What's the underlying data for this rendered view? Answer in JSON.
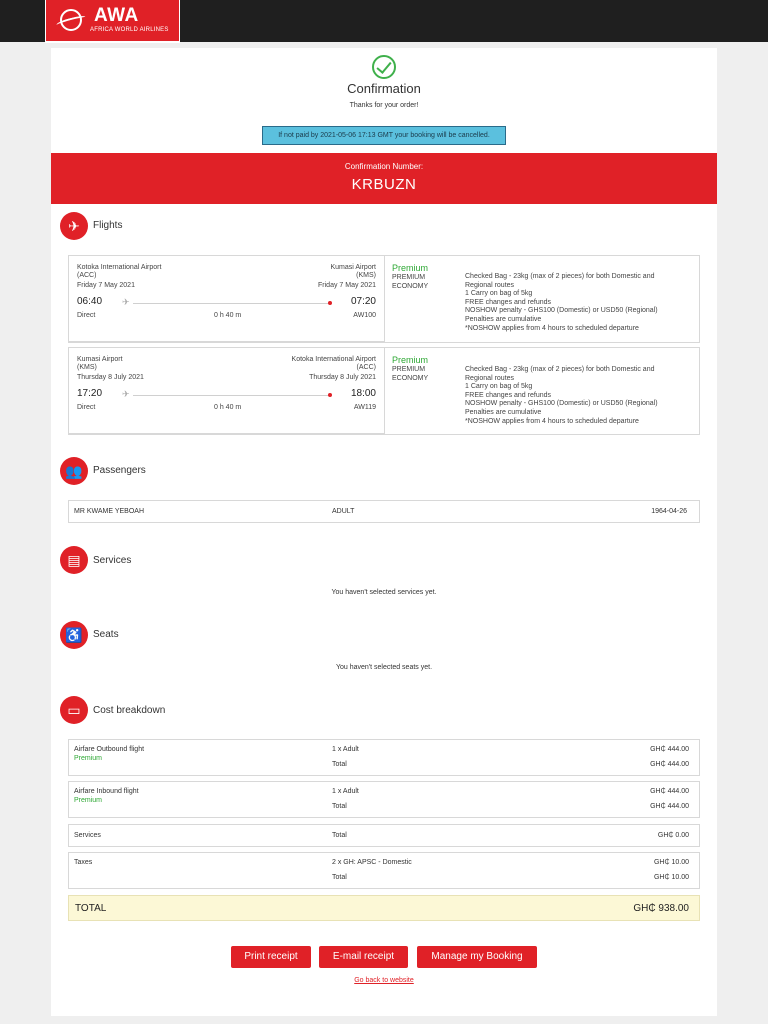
{
  "header": {
    "brand": "AWA",
    "brand_sub": "AFRICA WORLD AIRLINES"
  },
  "confirmation": {
    "title": "Confirmation",
    "thanks": "Thanks for your order!",
    "notice": "If not paid by 2021-05-06 17:13 GMT your booking will be cancelled.",
    "number_label": "Confirmation Number:",
    "number": "KRBUZN"
  },
  "flights": {
    "title": "Flights",
    "items": [
      {
        "from_airport": "Kotoka International Airport",
        "from_code": "(ACC)",
        "from_date": "Friday 7 May 2021",
        "dep_time": "06:40",
        "to_airport": "Kumasi Airport",
        "to_code": "(KMS)",
        "to_date": "Friday 7 May 2021",
        "arr_time": "07:20",
        "stops": "Direct",
        "duration": "0 h 40 m",
        "flight_no": "AW100",
        "fare_name": "Premium",
        "fare_class1": "PREMIUM",
        "fare_class2": "ECONOMY",
        "conditions": [
          "Checked Bag - 23kg (max of 2 pieces) for both Domestic and",
          "Regional routes",
          "1 Carry on bag of 5kg",
          "FREE changes and refunds",
          "NOSHOW penalty - GHS100 (Domestic) or USD50 (Regional)",
          "Penalties are cumulative",
          "*NOSHOW applies from 4 hours to scheduled departure"
        ]
      },
      {
        "from_airport": "Kumasi Airport",
        "from_code": "(KMS)",
        "from_date": "Thursday 8 July 2021",
        "dep_time": "17:20",
        "to_airport": "Kotoka International Airport",
        "to_code": "(ACC)",
        "to_date": "Thursday 8 July 2021",
        "arr_time": "18:00",
        "stops": "Direct",
        "duration": "0 h 40 m",
        "flight_no": "AW119",
        "fare_name": "Premium",
        "fare_class1": "PREMIUM",
        "fare_class2": "ECONOMY",
        "conditions": [
          "Checked Bag - 23kg (max of 2 pieces) for both Domestic and",
          "Regional routes",
          "1 Carry on bag of 5kg",
          "FREE changes and refunds",
          "NOSHOW penalty - GHS100 (Domestic) or USD50 (Regional)",
          "Penalties are cumulative",
          "*NOSHOW applies from 4 hours to scheduled departure"
        ]
      }
    ]
  },
  "passengers": {
    "title": "Passengers",
    "items": [
      {
        "name": "MR KWAME YEBOAH",
        "type": "ADULT",
        "dob": "1964-04-26"
      }
    ]
  },
  "services": {
    "title": "Services",
    "empty": "You haven't selected services yet."
  },
  "seats": {
    "title": "Seats",
    "empty": "You haven't selected seats yet."
  },
  "cost": {
    "title": "Cost breakdown",
    "outbound": {
      "label": "Airfare Outbound flight",
      "fare": "Premium",
      "qty": "1 x Adult",
      "qty_amount": "GH₵ 444.00",
      "total_label": "Total",
      "total": "GH₵ 444.00"
    },
    "inbound": {
      "label": "Airfare Inbound flight",
      "fare": "Premium",
      "qty": "1 x Adult",
      "qty_amount": "GH₵ 444.00",
      "total_label": "Total",
      "total": "GH₵ 444.00"
    },
    "services": {
      "label": "Services",
      "total_label": "Total",
      "total": "GH₵ 0.00"
    },
    "taxes": {
      "label": "Taxes",
      "qty": "2 x GH: APSC - Domestic",
      "qty_amount": "GH₵ 10.00",
      "total_label": "Total",
      "total": "GH₵ 10.00"
    },
    "grand_label": "TOTAL",
    "grand_total": "GH₵ 938.00"
  },
  "actions": {
    "print": "Print receipt",
    "email": "E-mail receipt",
    "manage": "Manage my Booking",
    "back": "Go back to website"
  }
}
